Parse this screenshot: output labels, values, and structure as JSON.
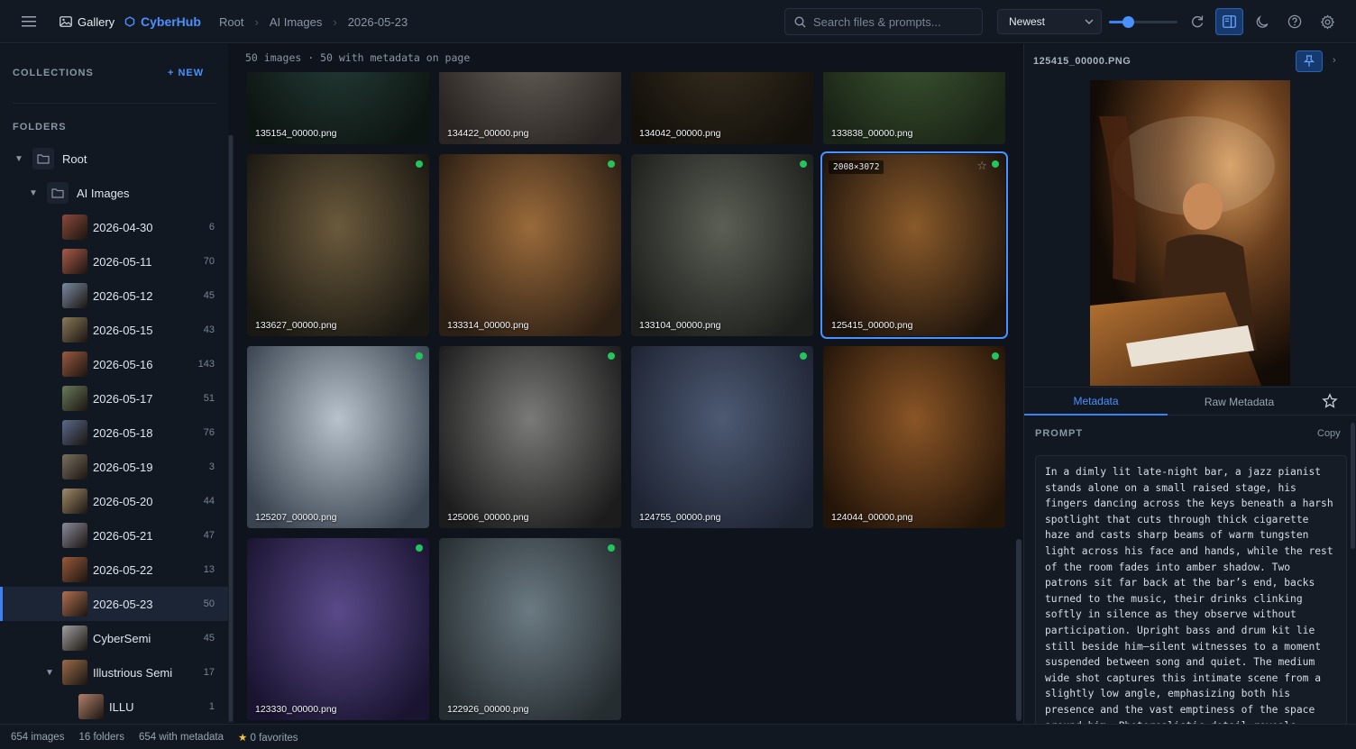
{
  "topbar": {
    "gallery_label": "Gallery",
    "brand": "CyberHub",
    "breadcrumbs": [
      "Root",
      "AI Images",
      "2026-05-23"
    ],
    "search_placeholder": "Search files & prompts...",
    "sort_value": "Newest",
    "thumb_size_fraction": 0.28
  },
  "sidebar": {
    "collections_label": "COLLECTIONS",
    "new_label": "+ NEW",
    "folders_label": "FOLDERS",
    "tree": [
      {
        "label": "Root",
        "count": "",
        "kind": "folder",
        "expanded": true
      },
      {
        "label": "AI Images",
        "count": "",
        "kind": "folder",
        "expanded": true
      },
      {
        "label": "2026-04-30",
        "count": "6",
        "kind": "thumb"
      },
      {
        "label": "2026-05-11",
        "count": "70",
        "kind": "thumb"
      },
      {
        "label": "2026-05-12",
        "count": "45",
        "kind": "thumb"
      },
      {
        "label": "2026-05-15",
        "count": "43",
        "kind": "thumb"
      },
      {
        "label": "2026-05-16",
        "count": "143",
        "kind": "thumb"
      },
      {
        "label": "2026-05-17",
        "count": "51",
        "kind": "thumb"
      },
      {
        "label": "2026-05-18",
        "count": "76",
        "kind": "thumb"
      },
      {
        "label": "2026-05-19",
        "count": "3",
        "kind": "thumb"
      },
      {
        "label": "2026-05-20",
        "count": "44",
        "kind": "thumb"
      },
      {
        "label": "2026-05-21",
        "count": "47",
        "kind": "thumb"
      },
      {
        "label": "2026-05-22",
        "count": "13",
        "kind": "thumb"
      },
      {
        "label": "2026-05-23",
        "count": "50",
        "kind": "thumb",
        "active": true
      },
      {
        "label": "CyberSemi",
        "count": "45",
        "kind": "thumb"
      },
      {
        "label": "Illustrious Semi",
        "count": "17",
        "kind": "thumb",
        "expanded": true
      },
      {
        "label": "ILLU",
        "count": "1",
        "kind": "thumb"
      }
    ]
  },
  "grid": {
    "header": "50 images · 50 with metadata on page",
    "images": [
      {
        "name": "135154_00000.png",
        "dot": false,
        "c1": "#27403a",
        "c2": "#0d1512"
      },
      {
        "name": "134422_00000.png",
        "dot": false,
        "c1": "#6d6660",
        "c2": "#2a2522"
      },
      {
        "name": "134042_00000.png",
        "dot": false,
        "c1": "#3a3020",
        "c2": "#14110c"
      },
      {
        "name": "133838_00000.png",
        "dot": false,
        "c1": "#3f5a34",
        "c2": "#1a2416"
      },
      {
        "name": "133627_00000.png",
        "dot": true,
        "c1": "#6b5a3c",
        "c2": "#1a1812"
      },
      {
        "name": "133314_00000.png",
        "dot": true,
        "c1": "#9a6a3a",
        "c2": "#2c1f14"
      },
      {
        "name": "133104_00000.png",
        "dot": true,
        "c1": "#5b5f55",
        "c2": "#1d1f1c"
      },
      {
        "name": "125415_00000.png",
        "dot": true,
        "c1": "#8a5a2a",
        "c2": "#1e140c",
        "selected": true,
        "dims": "2008×3072"
      },
      {
        "name": "125207_00000.png",
        "dot": true,
        "c1": "#b8c2cc",
        "c2": "#3a4450"
      },
      {
        "name": "125006_00000.png",
        "dot": true,
        "c1": "#7a7a78",
        "c2": "#1c1c1c"
      },
      {
        "name": "124755_00000.png",
        "dot": true,
        "c1": "#4d5a73",
        "c2": "#1f2433"
      },
      {
        "name": "124044_00000.png",
        "dot": true,
        "c1": "#8a5526",
        "c2": "#241509"
      },
      {
        "name": "123330_00000.png",
        "dot": true,
        "c1": "#5a4a8a",
        "c2": "#1a1430"
      },
      {
        "name": "122926_00000.png",
        "dot": true,
        "c1": "#6b7a82",
        "c2": "#262d31"
      }
    ]
  },
  "panel": {
    "title": "125415_00000.PNG",
    "tabs": [
      "Metadata",
      "Raw Metadata"
    ],
    "prompt_label": "PROMPT",
    "copy_label": "Copy",
    "prompt_text": "In a dimly lit late-night bar, a jazz pianist stands alone on a small raised stage, his fingers dancing across the keys beneath a harsh spotlight that cuts through thick cigarette haze and casts sharp beams of warm tungsten light across his face and hands, while the rest of the room fades into amber shadow. Two patrons sit far back at the bar’s end, backs turned to the music, their drinks clinking softly in silence as they observe without participation. Upright bass and drum kit lie still beside him—silent witnesses to a moment suspended between song and quiet. The medium wide shot captures this intimate scene from a slightly low angle, emphasizing both his presence and the vast emptiness of the space around him. Photorealistic detail reveals"
  },
  "status": {
    "images": "654 images",
    "folders": "16 folders",
    "metadata": "654 with metadata",
    "favorites": "0 favorites"
  },
  "colors": {
    "accent": "#3b82f6",
    "meta_dot": "#22c55e"
  }
}
